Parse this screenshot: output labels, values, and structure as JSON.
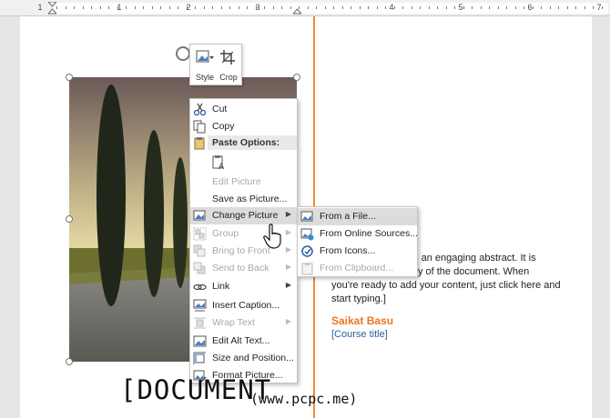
{
  "ruler": {
    "numbers": [
      "1",
      "1",
      "2",
      "3",
      "4",
      "5",
      "6",
      "7"
    ]
  },
  "mini_toolbar": {
    "style_label": "Style",
    "crop_label": "Crop"
  },
  "context_menu": {
    "items": [
      {
        "label": "Cut",
        "icon": "scissors-icon",
        "enabled": true
      },
      {
        "label": "Copy",
        "icon": "copy-icon",
        "enabled": true
      },
      {
        "label": "Paste Options:",
        "icon": "paste-icon",
        "header": true
      },
      {
        "label": "",
        "icon": "paste-keep-text-icon",
        "enabled": true
      },
      {
        "label": "Edit Picture",
        "icon": "",
        "enabled": false
      },
      {
        "label": "Save as Picture...",
        "icon": "",
        "enabled": true
      },
      {
        "label": "Change Picture",
        "icon": "change-picture-icon",
        "enabled": true,
        "submenu": true,
        "highlighted": true
      },
      {
        "label": "Group",
        "icon": "group-icon",
        "enabled": false,
        "submenu": true
      },
      {
        "label": "Bring to Front",
        "icon": "bring-front-icon",
        "enabled": false,
        "submenu": true
      },
      {
        "label": "Send to Back",
        "icon": "send-back-icon",
        "enabled": false,
        "submenu": true
      },
      {
        "label": "Link",
        "icon": "link-icon",
        "enabled": true,
        "submenu": true
      },
      {
        "label": "Insert Caption...",
        "icon": "caption-icon",
        "enabled": true
      },
      {
        "label": "Wrap Text",
        "icon": "wrap-text-icon",
        "enabled": false,
        "submenu": true
      },
      {
        "label": "Edit Alt Text...",
        "icon": "alt-text-icon",
        "enabled": true
      },
      {
        "label": "Size and Position...",
        "icon": "size-position-icon",
        "enabled": true
      },
      {
        "label": "Format Picture...",
        "icon": "format-picture-icon",
        "enabled": true
      }
    ]
  },
  "submenu": {
    "items": [
      {
        "label": "From a File...",
        "icon": "from-file-icon",
        "enabled": true,
        "highlighted": true
      },
      {
        "label": "From Online Sources...",
        "icon": "online-sources-icon",
        "enabled": true
      },
      {
        "label": "From Icons...",
        "icon": "icons-icon",
        "enabled": true
      },
      {
        "label": "From Clipboard...",
        "icon": "clipboard-icon",
        "enabled": false
      }
    ]
  },
  "document": {
    "abstract_lines": [
      "with an engaging abstract. It is",
      "mary of the document. When",
      "you're ready to add your content, just click here and",
      "start typing.]"
    ],
    "author": "Saikat Basu",
    "course": "[Course title]"
  },
  "watermark": {
    "text": "[DOCUMENT",
    "subtext": "(www.pcpc.me)"
  },
  "colors": {
    "accent_orange": "#f28a30",
    "author_orange": "#e87722",
    "course_blue": "#2e5e9e",
    "menu_highlight": "#dcdcdc"
  }
}
